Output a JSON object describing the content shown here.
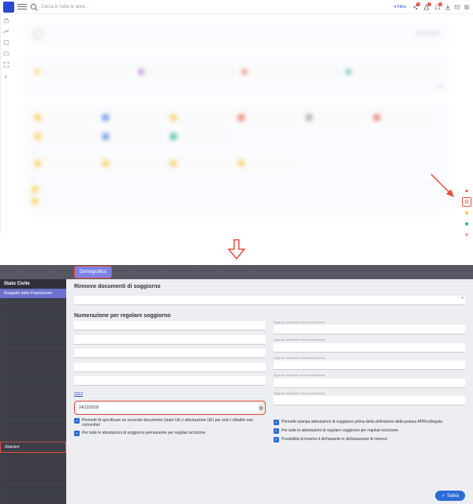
{
  "topbar": {
    "search_placeholder": "Cerca in tutte le aree...",
    "filtra": "Filtra",
    "badges": [
      "1",
      "1",
      "1"
    ]
  },
  "dashboard": {
    "header_sub": "",
    "header_main": "",
    "responsabile_label": "Responsabile",
    "responsabile_name": "",
    "statuses": [
      {
        "label": "",
        "color": "#f4c430"
      },
      {
        "label": "",
        "color": "#8e44ad"
      },
      {
        "label": "",
        "color": "#e74c3c"
      },
      {
        "label": "",
        "color": "#16a085"
      }
    ],
    "modules": [
      {
        "color": "#f4c430"
      },
      {
        "color": "#2c6cd6"
      },
      {
        "color": "#f4c430"
      },
      {
        "color": "#e74c3c"
      },
      {
        "color": "#888"
      },
      {
        "color": "#e74c3c"
      },
      {
        "color": "#f4c430"
      },
      {
        "color": "#2c6cd6"
      },
      {
        "color": "#16a085"
      }
    ],
    "practices_label": "",
    "scadenze_label": ""
  },
  "tabs": {
    "items": [
      "",
      "",
      "Demografico",
      "",
      "",
      "",
      "",
      ""
    ],
    "active_index": 2
  },
  "sidebar": {
    "title": "Stato Civile",
    "subtitle": "Anagrafe della Popolazione",
    "items": [
      "",
      "",
      "",
      "",
      "",
      "",
      "",
      "",
      "",
      "",
      "",
      "",
      "",
      "",
      "Stranieri",
      "",
      "",
      "",
      "",
      ""
    ],
    "highlight_index": 14
  },
  "settings": {
    "section1_title": "Rinnovo documenti di soggiorno",
    "section1_sub": "",
    "section2_title": "Numerazione per regolare soggiorno",
    "left_fields": [
      "",
      "",
      "",
      "",
      "",
      ""
    ],
    "right_fields": [
      "Sigla da utilizzare nella numerazione",
      "Sigla da utilizzare nella numerazione",
      "Sigla da utilizzare nella numerazione",
      "Sigla da utilizzare nella numerazione",
      "Sigla da utilizzare nella numerazione"
    ],
    "link_year": "2022",
    "date_label": "",
    "date_value": "24/12/2018",
    "check_left_1": "Permetti di specificare un secondo documento (stato UE o attestazione UE) per solo i cittadini non comunitari",
    "check_left_2": "Per tutte le attestazioni di soggiorno permanente per regolari iscrizione",
    "check_right_0": "Permetti stampa attestazioni di soggiorno prima della definizione della pratica APR/collegata",
    "check_right_1": "Per tutte le attestazioni di regolare soggiorno per regolari iscrizione",
    "check_right_2": "Possibilità di inserire il dichiarante in dichiarazione di rinnovo",
    "save_btn": "Salva"
  }
}
